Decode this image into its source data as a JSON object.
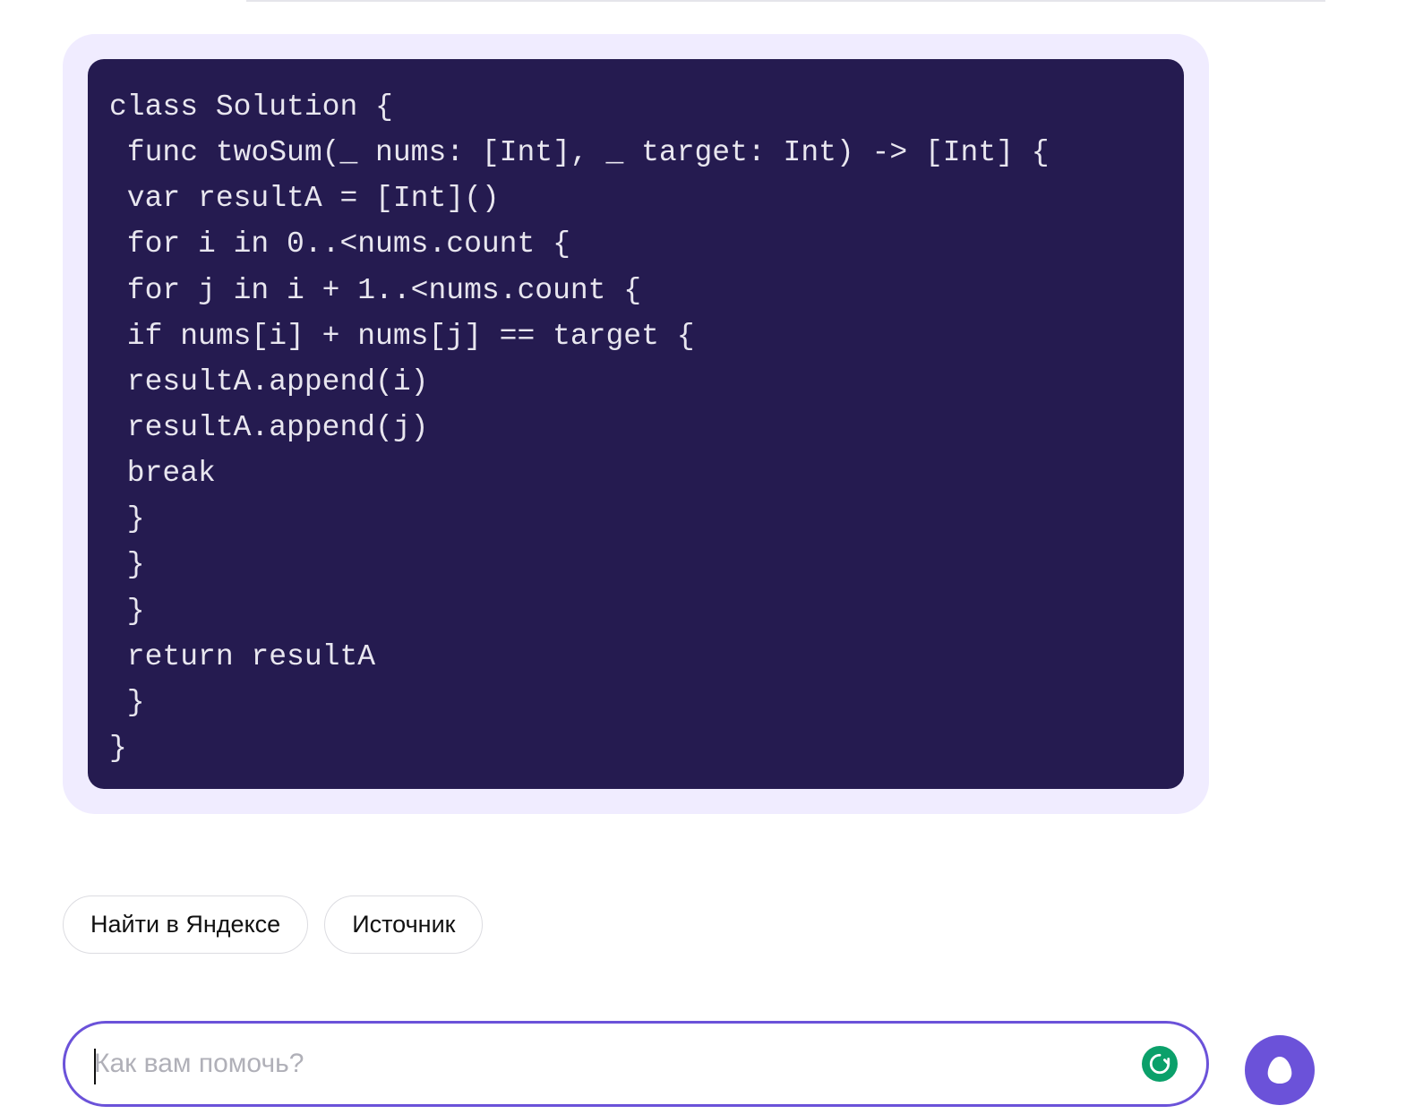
{
  "code": {
    "content": "class Solution {\n func twoSum(_ nums: [Int], _ target: Int) -> [Int] {\n var resultA = [Int]()\n for i in 0..<nums.count {\n for j in i + 1..<nums.count {\n if nums[i] + nums[j] == target {\n resultA.append(i)\n resultA.append(j)\n break\n }\n }\n }\n return resultA\n }\n}"
  },
  "buttons": {
    "search_yandex": "Найти в Яндексе",
    "source": "Источник"
  },
  "input": {
    "placeholder": "Как вам помочь?",
    "value": ""
  }
}
